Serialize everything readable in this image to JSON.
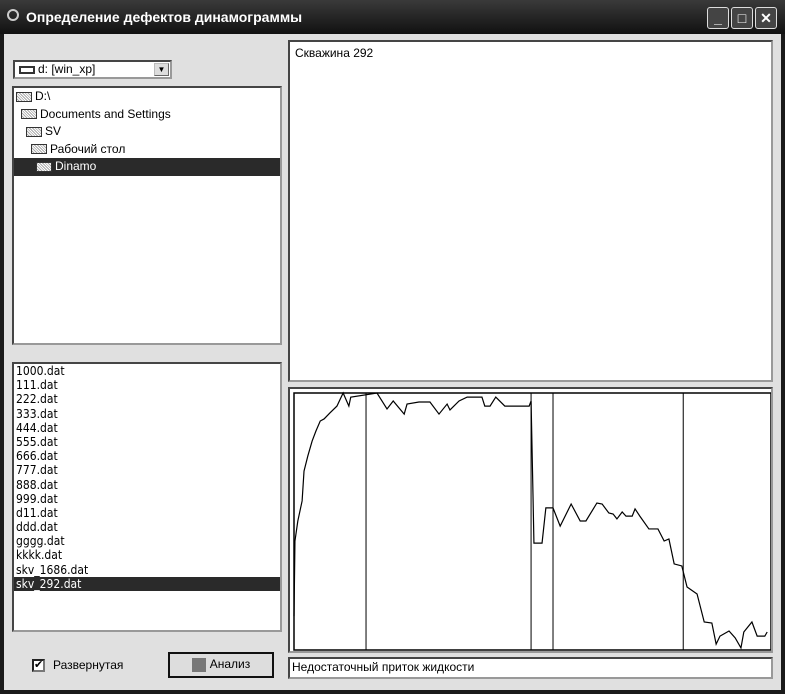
{
  "window": {
    "title": "Определение дефектов динамограммы",
    "buttons": [
      "_",
      "□",
      "✕"
    ]
  },
  "drive": {
    "value": "d: [win_xp]"
  },
  "folders": [
    "D:\\",
    "Documents and Settings",
    "SV",
    "Рабочий стол",
    "Dinamo"
  ],
  "selected_folder": "Dinamo",
  "files": [
    "1000.dat",
    "111.dat",
    "222.dat",
    "333.dat",
    "444.dat",
    "555.dat",
    "666.dat",
    "777.dat",
    "888.dat",
    "999.dat",
    "d11.dat",
    "ddd.dat",
    "gggg.dat",
    "kkkk.dat",
    "skv_1686.dat",
    "skv_292.dat"
  ],
  "selected_file": "skv_292.dat",
  "checkbox": {
    "label": "Развернутая",
    "checked": true
  },
  "analyze_button": "Анализ",
  "info_text": "Скважина 292",
  "result_text": "Недостаточный приток жидкости",
  "chart_data": {
    "type": "line",
    "xlim": [
      0,
      100
    ],
    "ylim": [
      0,
      100
    ],
    "vlines": [
      15.1,
      49.7,
      54.3,
      81.6
    ],
    "x": [
      0,
      0.2,
      0.8,
      1.7,
      2.1,
      2.9,
      3.8,
      4.6,
      5.5,
      6.3,
      7.5,
      9.0,
      10.3,
      11.5,
      11.9,
      17.4,
      19.5,
      20.8,
      23.1,
      23.7,
      26.2,
      28.5,
      30.4,
      32.1,
      32.7,
      34.6,
      36.3,
      39.4,
      40.0,
      41.1,
      42.3,
      44.2,
      49.3,
      49.7,
      50.1,
      50.3,
      52.0,
      52.8,
      54.3,
      55.8,
      58.1,
      60.0,
      61.2,
      63.5,
      64.6,
      66.0,
      66.9,
      67.7,
      68.8,
      69.6,
      70.9,
      71.5,
      72.5,
      74.4,
      76.3,
      77.6,
      78.6,
      79.7,
      81.3,
      82.4,
      84.5,
      86.0,
      87.6,
      88.5,
      89.3,
      91.2,
      92.5,
      93.7,
      94.3,
      96.0,
      97.1,
      98.7,
      99.2
    ],
    "y": [
      13.2,
      42.4,
      50.2,
      58.0,
      69.6,
      75.5,
      81.3,
      85.2,
      89.1,
      89.9,
      92.2,
      94.9,
      100,
      94.9,
      98.4,
      100,
      93.8,
      96.9,
      91.8,
      95.7,
      96.5,
      96.5,
      91.8,
      95.7,
      93.4,
      96.9,
      98.4,
      98.4,
      94.9,
      94.9,
      98.4,
      94.9,
      94.9,
      96.9,
      60.7,
      41.6,
      41.6,
      55.3,
      55.3,
      48.2,
      56.8,
      50.2,
      50.2,
      57.2,
      56.8,
      53.3,
      52.9,
      51.0,
      53.7,
      52.1,
      52.1,
      54.9,
      52.1,
      47.1,
      47.1,
      42.4,
      43.2,
      33.5,
      32.7,
      24.5,
      21.8,
      10.9,
      10.5,
      2.3,
      5.4,
      7.4,
      4.7,
      0.8,
      7.0,
      10.9,
      5.4,
      5.4,
      7.0
    ]
  }
}
